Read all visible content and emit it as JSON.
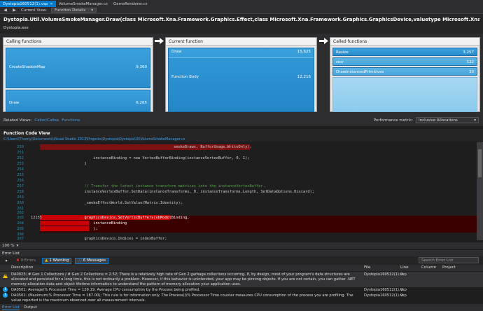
{
  "tabs": [
    {
      "label": "Dystopia160512(1).vsp",
      "active": true
    },
    {
      "label": "VolumeSmokeManager.cs",
      "active": false
    },
    {
      "label": "GameRenderer.cs",
      "active": false
    }
  ],
  "view": {
    "label": "Current View:",
    "value": "Function Details"
  },
  "header": {
    "title": "Dystopia.Util.VolumeSmokeManager.Draw(class Microsoft.Xna.Framework.Graphics.Effect,class Microsoft.Xna.Framework.Graphics.GraphicsDevice,valuetype Microsoft.Xna.Framework.BoundingBox,string,valuetype Microsoft.Xna.Framework.Ma",
    "module": "Dystopia.exe"
  },
  "calling": {
    "title": "Calling functions",
    "items": [
      {
        "label": "CreateShadowMap",
        "value": "9,360"
      },
      {
        "label": "Draw",
        "value": "6,265"
      }
    ]
  },
  "current": {
    "title": "Current function",
    "name": "Draw",
    "total": "15,625",
    "body_label": "Function Body",
    "body_value": "12,216"
  },
  "called": {
    "title": "Called functions",
    "items": [
      {
        "label": "Resize",
        "value": "3,257"
      },
      {
        "label": "ctor",
        "value": "122"
      },
      {
        "label": "DrawInstancedPrimitives",
        "value": "30"
      }
    ]
  },
  "related": {
    "label": "Related Views:",
    "link1": "Caller/Callee",
    "link2": "Functions"
  },
  "perf": {
    "label": "Performance metric:",
    "value": "Inclusive Allocations"
  },
  "code": {
    "title": "Function Code View",
    "path": "C:\\Users\\Thomy\\Documents\\Visual Studio 2013\\Projects\\Dystopia\\Dystopia\\IX\\VolumeSmokeManager.cs",
    "lines": [
      {
        "n": "250",
        "s": "",
        "t": "                                                smokeDraws, BufferUsage.WriteOnly);"
      },
      {
        "n": "251",
        "s": "",
        "t": ""
      },
      {
        "n": "252",
        "s": "",
        "t": "            instanceBinding = new VertexBufferBinding(instanceVertexBuffer, 0, 1);"
      },
      {
        "n": "253",
        "s": "",
        "t": "        }"
      },
      {
        "n": "254",
        "s": "",
        "t": ""
      },
      {
        "n": "255",
        "s": "",
        "t": ""
      },
      {
        "n": "256",
        "s": "",
        "t": ""
      },
      {
        "n": "257",
        "s": "",
        "t": "        // Transfer the latest instance transform matrices into the instanceVertexBuffer."
      },
      {
        "n": "258",
        "s": "",
        "t": "        instanceVertexBuffer.SetData(instanceTransforms, 0, instanceTransforms.Length, SetDataOptions.Discard);"
      },
      {
        "n": "259",
        "s": "",
        "t": ""
      },
      {
        "n": "260",
        "s": "",
        "t": "        _smokeEffectWorld.SetValue(Matrix.Identity);"
      },
      {
        "n": "261",
        "s": "",
        "t": ""
      },
      {
        "n": "262",
        "s": "",
        "t": ""
      },
      {
        "n": "263",
        "s": "12155",
        "t": "        graphicsDevice.SetVertexBuffers(vbModelBinding,"
      },
      {
        "n": "264",
        "s": "",
        "t": "            instanceBinding"
      },
      {
        "n": "265",
        "s": "",
        "t": "            );"
      },
      {
        "n": "266",
        "s": "",
        "t": ""
      },
      {
        "n": "267",
        "s": "",
        "t": "        graphicsDevice.Indices = indexBuffer;"
      }
    ]
  },
  "zoom": "100 %",
  "errors": {
    "title": "Error List",
    "errors_btn": "0 Errors",
    "warnings_btn": "1 Warning",
    "messages_btn": "6 Messages",
    "search": "Search Error List",
    "cols": {
      "desc": "Description",
      "file": "File",
      "line": "Line",
      "col": "Column",
      "proj": "Project"
    },
    "rows": [
      {
        "icon": "warning",
        "desc": "DA0023: # Gen 1 Collections / # Gen 2 Collections = 2.52; There is a relatively high rate of Gen 2 garbage collections occurring. If, by design, most of your program's data structures are allocated and persisted for a long time, this is not ordinarily a problem. However, if this behavior is unintended, your app may be pinning objects. If you are not certain, you can gather .NET memory allocation data and object lifetime information to understand the pattern of memory allocation your application uses.",
        "file": "Dystopia160512(1).vsp",
        "line": "0"
      },
      {
        "icon": "info",
        "desc": "DA0501: Average(% Processor Time = 129.19; Average CPU consumption by the Process being profiled.",
        "file": "Dystopia160512(1).vsp",
        "line": "0"
      },
      {
        "icon": "info",
        "desc": "DA0502: (Maximum(% Processor Time = 187.00); This rule is for information only. The Process()\\% Processor Time counter measures CPU consumption of the process you are profiling. The value reported is the maximum observed over all measurement intervals.",
        "file": "Dystopia160512(1).vsp",
        "line": "0"
      }
    ]
  },
  "bottom_tabs": [
    "Error List",
    "Output"
  ]
}
